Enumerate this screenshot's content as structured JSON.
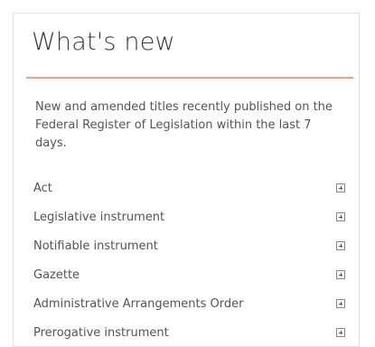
{
  "panel": {
    "title": "What's new",
    "intro": "New and amended titles recently published on the Federal Register of Legislation within the last 7 days."
  },
  "items": [
    {
      "label": "Act",
      "icon": "plus-box-icon"
    },
    {
      "label": "Legislative instrument",
      "icon": "plus-box-icon"
    },
    {
      "label": "Notifiable instrument",
      "icon": "plus-box-icon"
    },
    {
      "label": "Gazette",
      "icon": "plus-box-icon"
    },
    {
      "label": "Administrative Arrangements Order",
      "icon": "plus-box-icon"
    },
    {
      "label": "Prerogative instrument",
      "icon": "plus-box-icon"
    }
  ],
  "colors": {
    "accent_rule": "#e8a484",
    "text": "#555555"
  }
}
